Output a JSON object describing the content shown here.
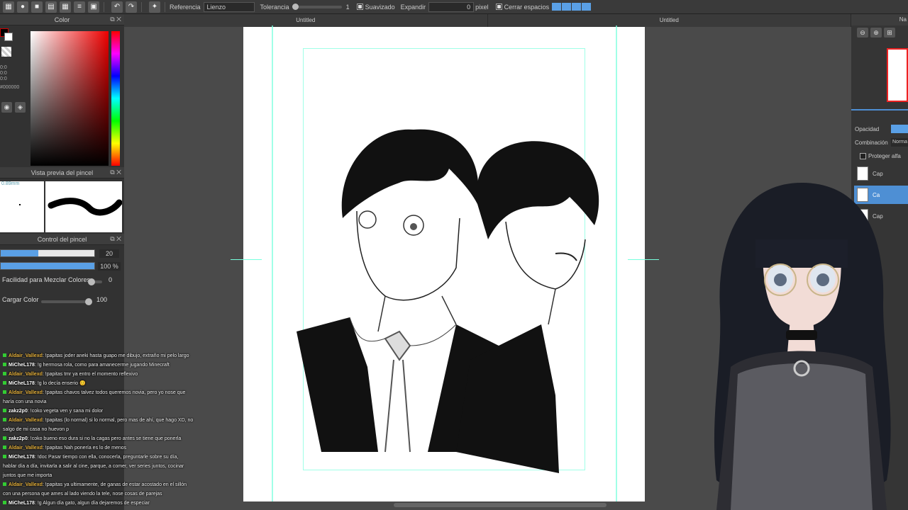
{
  "toolbar": {
    "referencia_label": "Referencia",
    "referencia_value": "Lienzo",
    "tolerancia_label": "Tolerancia",
    "tolerancia_value": "1",
    "suavizado_label": "Suavizado",
    "expandir_label": "Expandir",
    "expandir_value": "0",
    "expandir_unit": "pixel",
    "cerrar_label": "Cerrar espacios"
  },
  "color_panel": {
    "title": "Color",
    "rgb": [
      "0:0",
      "0:0",
      "0:0"
    ],
    "hex": "#000000"
  },
  "brush_preview": {
    "title": "Vista previa del pincel",
    "size": "0.89mm"
  },
  "brush_control": {
    "title": "Control del pincel",
    "size_value": "20",
    "size_fraction": 0.4,
    "opacity_value": "100 %",
    "opacity_fraction": 1.0,
    "mix_label": "Facilidad para Mezclar Colores",
    "mix_value": "0",
    "load_label": "Cargar Color",
    "load_value": "100"
  },
  "canvas": {
    "tab_left": "Untitled",
    "tab_right": "Untitled"
  },
  "right_panel": {
    "head": "Na",
    "opacity_label": "Opacidad",
    "blend_label": "Combinación",
    "blend_value": "Norma",
    "protect_label": "Proteger alfa",
    "layers": [
      "Cap",
      "Ca",
      "Cap"
    ]
  },
  "chat": [
    {
      "user": "Aldair_Vallexd",
      "msg": ": !papitas joder aneki hasta guapo me dibujo, extraño mi pelo largo",
      "gold": true
    },
    {
      "user": "MiCheL178",
      "msg": ": !g hermosa rola, como para amanecerme jugando Minecraft",
      "gold": false
    },
    {
      "user": "Aldair_Vallexd",
      "msg": ": !papitas tmr ya entro el momento reflexivo",
      "gold": true
    },
    {
      "user": "MiCheL178",
      "msg": ": !g lo decía enserio 😊",
      "gold": false
    },
    {
      "user": "Aldair_Vallexd",
      "msg": ": !papitas chavos talvez todos queremos novia, pero yo nose que",
      "gold": true
    },
    {
      "user": "",
      "msg": "haría con una novia",
      "gold": false
    },
    {
      "user": "zakz2p0",
      "msg": ": !coko vegeta ven y sana mi dolor",
      "gold": false
    },
    {
      "user": "Aldair_Vallexd",
      "msg": ": !papitas (lo normal) si lo normal, pero mas de ahí, que hago XD, no",
      "gold": true
    },
    {
      "user": "",
      "msg": "salgo de mi casa no huevon p",
      "gold": false
    },
    {
      "user": "zakz2p0",
      "msg": ": !coko bueno eso dura si no la cagas pero antes se tiene que ponerla",
      "gold": false
    },
    {
      "user": "Aldair_Vallexd",
      "msg": ": !papitas Nah ponería es lo de menos",
      "gold": true
    },
    {
      "user": "MiCheL178",
      "msg": ": !doc Pasar tiempo con ella, conocerla, preguntarle sobre su día,",
      "gold": false
    },
    {
      "user": "",
      "msg": "hablar día a día, invitarla a salir al cine, parque, a comer, ver series juntos, cocinar",
      "gold": false
    },
    {
      "user": "",
      "msg": "juntos que me importa",
      "gold": false
    },
    {
      "user": "Aldair_Vallexd",
      "msg": ": !papitas ya ultimamente, de ganas de estar acostado en el sillón",
      "gold": true
    },
    {
      "user": "",
      "msg": "con una persona que ames al lado viendo la tele, nose cosas de parejas",
      "gold": false
    },
    {
      "user": "MiCheL178",
      "msg": ": !g Algun día gato, algun día dejaremos de especiar",
      "gold": false
    }
  ]
}
